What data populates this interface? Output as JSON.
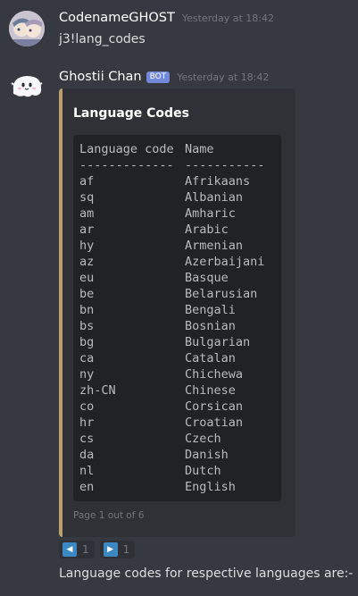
{
  "messages": [
    {
      "username": "CodenameGHOST",
      "timestamp": "Yesterday at 18:42",
      "content": "j3!lang_codes"
    },
    {
      "username": "Ghostii Chan",
      "badge": "BOT",
      "timestamp": "Yesterday at 18:42"
    }
  ],
  "embed": {
    "title": "Language Codes",
    "accent_color": "#b9a06e",
    "code_header": [
      "Language code",
      "Name"
    ],
    "code_divider": [
      "-------------",
      "-----------"
    ],
    "rows": [
      {
        "code": "af",
        "name": "Afrikaans"
      },
      {
        "code": "sq",
        "name": "Albanian"
      },
      {
        "code": "am",
        "name": "Amharic"
      },
      {
        "code": "ar",
        "name": "Arabic"
      },
      {
        "code": "hy",
        "name": "Armenian"
      },
      {
        "code": "az",
        "name": "Azerbaijani"
      },
      {
        "code": "eu",
        "name": "Basque"
      },
      {
        "code": "be",
        "name": "Belarusian"
      },
      {
        "code": "bn",
        "name": "Bengali"
      },
      {
        "code": "bs",
        "name": "Bosnian"
      },
      {
        "code": "bg",
        "name": "Bulgarian"
      },
      {
        "code": "ca",
        "name": "Catalan"
      },
      {
        "code": "ny",
        "name": "Chichewa"
      },
      {
        "code": "zh-CN",
        "name": "Chinese"
      },
      {
        "code": "co",
        "name": "Corsican"
      },
      {
        "code": "hr",
        "name": "Croatian"
      },
      {
        "code": "cs",
        "name": "Czech"
      },
      {
        "code": "da",
        "name": "Danish"
      },
      {
        "code": "nl",
        "name": "Dutch"
      },
      {
        "code": "en",
        "name": "English"
      }
    ],
    "footer": "Page 1 out of 6"
  },
  "reactions": [
    {
      "icon": "arrow-left-icon",
      "glyph": "◀",
      "count": "1"
    },
    {
      "icon": "arrow-right-icon",
      "glyph": "▶",
      "count": "1"
    }
  ],
  "followup_text": "Language codes for respective languages are:-",
  "colors": {
    "background": "#36393f",
    "embed_background": "#2f3136",
    "code_background": "#202225",
    "bot_badge": "#7289da",
    "reaction_emoji": "#3b88c3"
  }
}
